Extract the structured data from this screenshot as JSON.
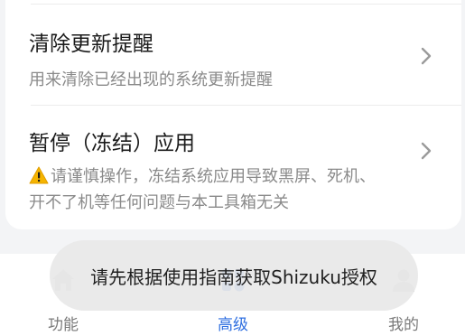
{
  "settings": {
    "items": [
      {
        "title": "清除更新提醒",
        "description": "用来清除已经出现的系统更新提醒"
      },
      {
        "title": "暂停（冻结）应用",
        "warning_icon": "warning-icon",
        "description": "请谨慎操作，冻结系统应用导致黑屏、死机、开不了机等任何问题与本工具箱无关"
      }
    ]
  },
  "bottom_nav": {
    "items": [
      {
        "label": "功能",
        "icon": "home-icon",
        "active": false
      },
      {
        "label": "高级",
        "icon": "advanced-icon",
        "active": true
      },
      {
        "label": "我的",
        "icon": "profile-icon",
        "active": false
      }
    ]
  },
  "toast": {
    "message": "请先根据使用指南获取Shizuku授权"
  },
  "colors": {
    "accent": "#2f6fe0",
    "nav_inactive": "#7a7a7a",
    "title": "#1a1a1a",
    "description": "#8a8a8a",
    "warning": "#f5b400"
  }
}
